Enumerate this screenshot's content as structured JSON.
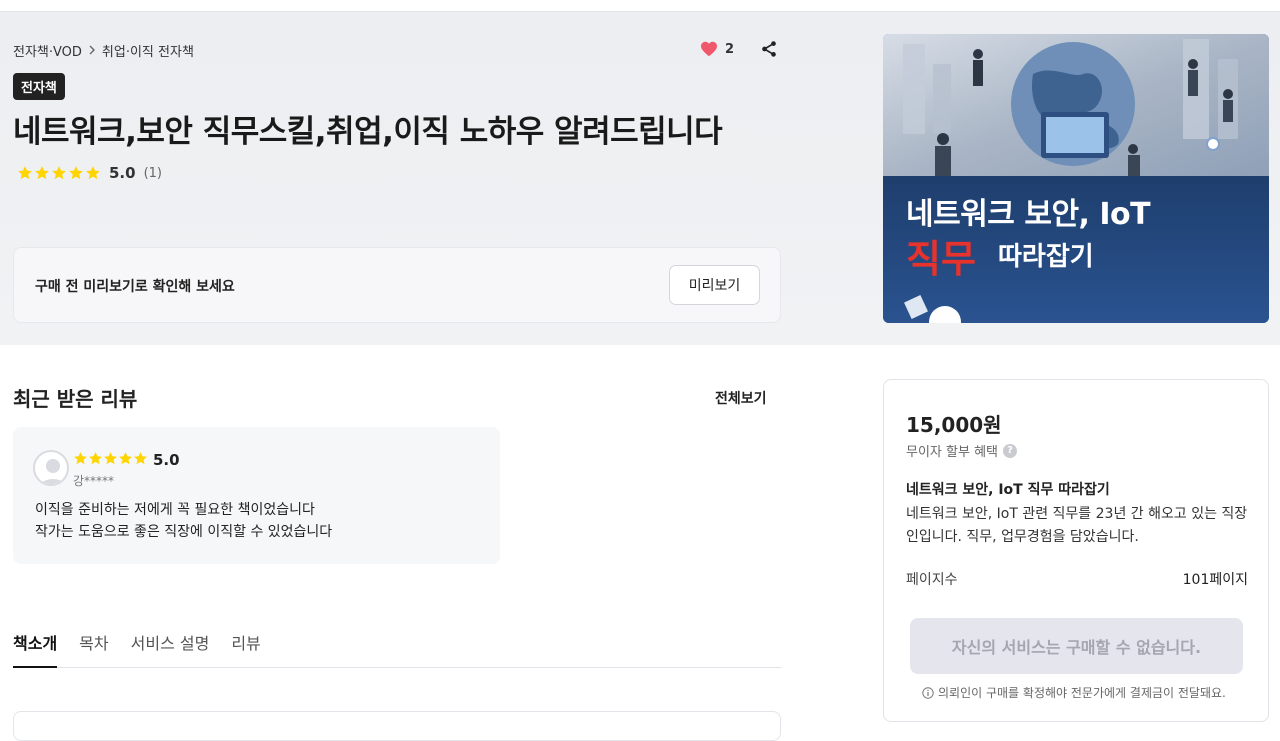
{
  "breadcrumb": {
    "category": "전자책·VOD",
    "subcategory": "취업·이직 전자책"
  },
  "likes": {
    "count": "2"
  },
  "badge": "전자책",
  "title": "네트워크,보안 직무스킬,취업,이직 노하우 알려드립니다",
  "rating": {
    "score": "5.0",
    "count": "(1)",
    "stars": 5
  },
  "preview": {
    "text": "구매 전 미리보기로 확인해 보세요",
    "button": "미리보기"
  },
  "cover": {
    "line1": "네트워크 보안, IoT",
    "line2": "직무",
    "line3": "따라잡기"
  },
  "reviews": {
    "heading": "최근 받은 리뷰",
    "view_all": "전체보기",
    "items": [
      {
        "score": "5.0",
        "author": "강*****",
        "line1": "이직을 준비하는 저에게 꼭 필요한 책이었습니다",
        "line2": "작가는 도움으로 좋은 직장에 이직할 수 있었습니다"
      }
    ]
  },
  "tabs": [
    {
      "label": "책소개"
    },
    {
      "label": "목차"
    },
    {
      "label": "서비스 설명"
    },
    {
      "label": "리뷰"
    }
  ],
  "purchase": {
    "price": "15,000원",
    "installment": "무이자 할부 혜택",
    "package_title": "네트워크 보안, IoT 직무 따라잡기",
    "package_desc": "네트워크 보안, IoT 관련 직무를 23년 간 해오고 있는 직장인입니다. 직무, 업무경험을 담았습니다.",
    "pages_label": "페이지수",
    "pages_value": "101페이지",
    "buy_button": "자신의 서비스는 구매할 수 없습니다.",
    "notice": "의뢰인이 구매를 확정해야 전문가에게 결제금이 전달돼요."
  },
  "colors": {
    "star": "#FFD400",
    "heart": "#F0576B",
    "cover_accent": "#E8322C",
    "cover_bg": "#24508C"
  }
}
